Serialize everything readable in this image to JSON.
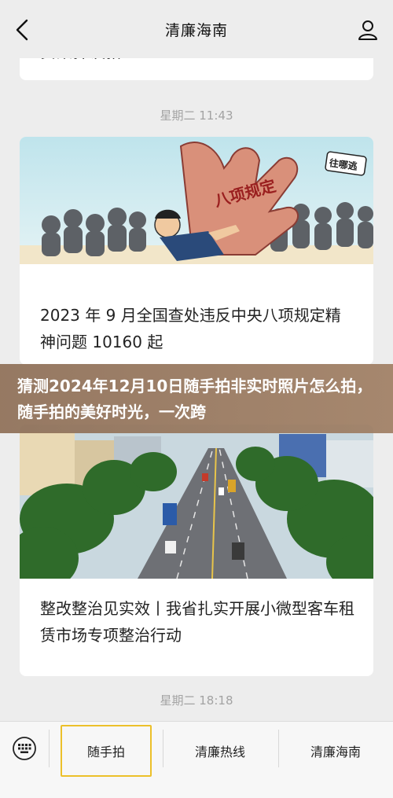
{
  "header": {
    "title": "清廉海南",
    "back_icon": "chevron-left-icon",
    "profile_icon": "person-icon"
  },
  "top_card": {
    "clipped_text": "贪染择议拾"
  },
  "messages": [
    {
      "timestamp": "星期二 11:43",
      "title": "2023 年 9 月全国查处违反中央八项规定精神问题 10160 起",
      "image": {
        "hand_text": "八项规定",
        "tag_text": "往哪逃"
      }
    },
    {
      "title": "整改整治见实效丨我省扎实开展小微型客车租赁市场专项整治行动"
    }
  ],
  "bottom_timestamp": "星期二 18:18",
  "banner": {
    "text": "猜测2024年12月10日随手拍非实时照片怎么拍，随手拍的美好时光，一次跨"
  },
  "bottom_menu": {
    "keyboard_icon": "keyboard-icon",
    "items": [
      "随手拍",
      "清廉热线",
      "清廉海南"
    ]
  },
  "colors": {
    "background": "#ededed",
    "banner": "#8f7058",
    "active_outline": "#ecc02a",
    "hand": "#d9907a"
  }
}
